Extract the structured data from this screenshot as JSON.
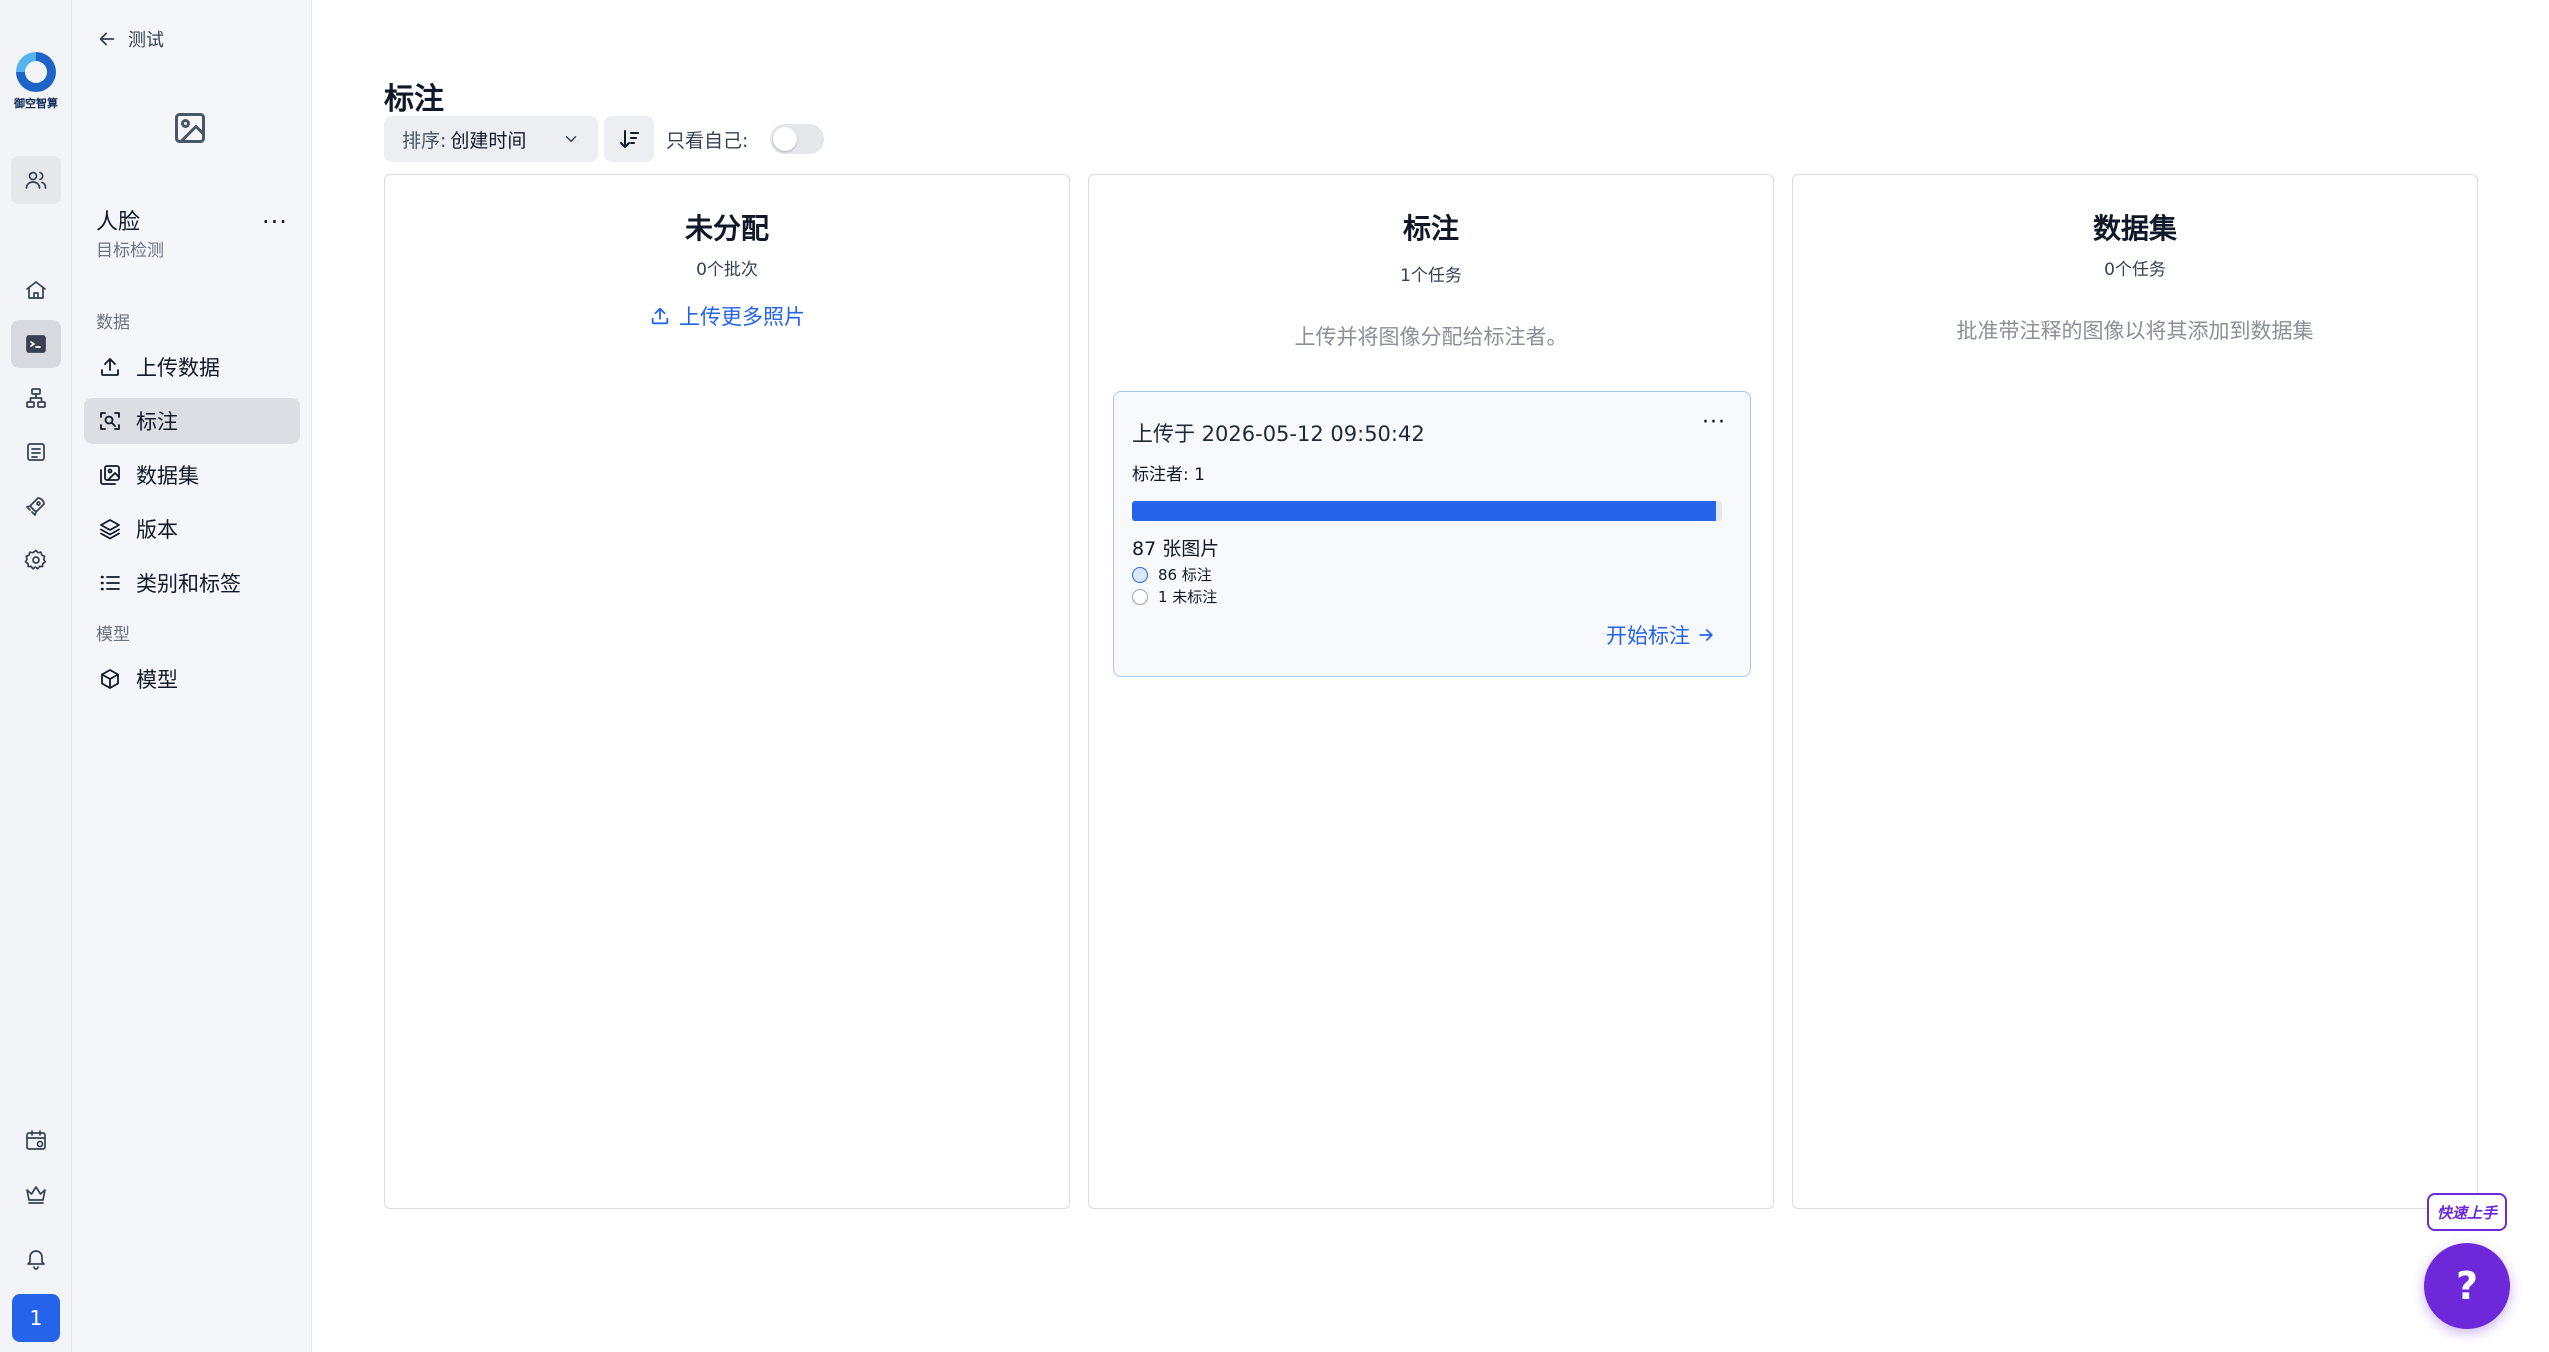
{
  "brand": {
    "logo_text": "御空智算"
  },
  "rail": {
    "avatar_label": "1"
  },
  "sidebar": {
    "back_label": "测试",
    "project_name": "人脸",
    "project_type": "目标检测",
    "more_label": "···",
    "section_data": "数据",
    "section_model": "模型",
    "items": [
      {
        "label": "上传数据",
        "icon": "upload-icon"
      },
      {
        "label": "标注",
        "icon": "annotate-icon"
      },
      {
        "label": "数据集",
        "icon": "gallery-icon"
      },
      {
        "label": "版本",
        "icon": "layers-icon"
      },
      {
        "label": "类别和标签",
        "icon": "list-icon"
      },
      {
        "label": "模型",
        "icon": "cube-icon"
      }
    ]
  },
  "main": {
    "title": "标注",
    "sort_key": "排序:",
    "sort_value": "创建时间",
    "only_me_label": "只看自己:",
    "only_me_on": false
  },
  "columns": {
    "unassigned": {
      "title": "未分配",
      "subtitle": "0个批次",
      "upload_link": "上传更多照片"
    },
    "annotating": {
      "title": "标注",
      "subtitle": "1个任务",
      "hint": "上传并将图像分配给标注者。",
      "card": {
        "uploaded": "上传于 2026-05-12 09:50:42",
        "annotators": "标注者: 1",
        "image_count": "87 张图片",
        "annotated": "86 标注",
        "unannotated": "1 未标注",
        "progress_fraction": 0.989,
        "more_label": "···",
        "start_label": "开始标注"
      }
    },
    "dataset": {
      "title": "数据集",
      "subtitle": "0个任务",
      "hint": "批准带注释的图像以将其添加到数据集"
    }
  },
  "help": {
    "quick_label": "快速上手",
    "help_label": "?"
  },
  "colors": {
    "accent": "#2563eb",
    "help_purple": "#6d28d9"
  }
}
